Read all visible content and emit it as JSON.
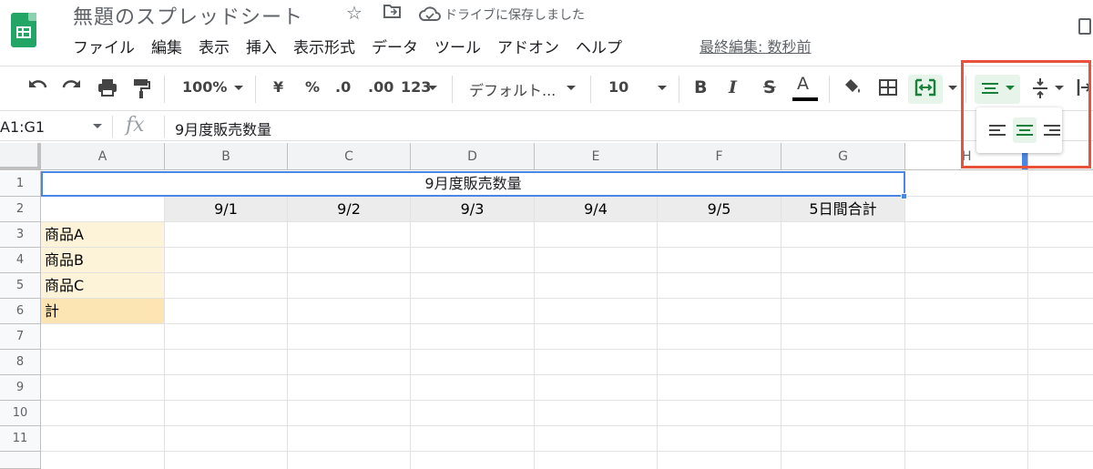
{
  "header": {
    "doc_title": "無題のスプレッドシート",
    "save_status": "ドライブに保存しました",
    "last_edit": "最終編集: 数秒前"
  },
  "menu": [
    "ファイル",
    "編集",
    "表示",
    "挿入",
    "表示形式",
    "データ",
    "ツール",
    "アドオン",
    "ヘルプ"
  ],
  "toolbar": {
    "zoom": "100%",
    "currency": "¥",
    "percent": "%",
    "decrease_decimal": ".0",
    "increase_decimal": ".00",
    "more_formats": "123",
    "font": "デフォルト...",
    "font_size": "10",
    "bold": "B",
    "italic": "I",
    "strike": "S",
    "text_color": "A"
  },
  "formula_bar": {
    "name_box": "A1:G1",
    "fx": "fx",
    "content": "9月度販売数量"
  },
  "columns": [
    "A",
    "B",
    "C",
    "D",
    "E",
    "F",
    "G",
    "H"
  ],
  "rows": [
    "1",
    "2",
    "3",
    "4",
    "5",
    "6",
    "7",
    "8",
    "9",
    "10",
    "11"
  ],
  "sheet": {
    "merged_title": "9月度販売数量",
    "dates": [
      "9/1",
      "9/2",
      "9/3",
      "9/4",
      "9/5",
      "5日間合計"
    ],
    "products": [
      "商品A",
      "商品B",
      "商品C"
    ],
    "total_label": "計"
  },
  "colors": {
    "accent_green": "#23a566",
    "selection_blue": "#4a86e8",
    "highlight_red": "#e8523a",
    "product_fill": "#fdf3d8",
    "total_fill": "#fde5b3"
  }
}
